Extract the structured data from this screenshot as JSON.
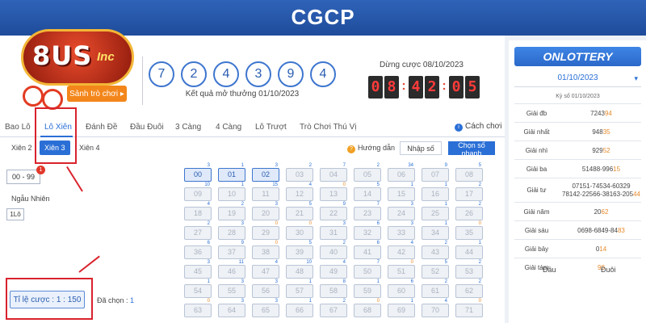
{
  "banner": {
    "title": "CGCP"
  },
  "logo": {
    "brand": "8US",
    "suffix": "Inc"
  },
  "play_button": "Sảnh trò chơi ▸",
  "results": {
    "numbers": [
      "7",
      "2",
      "4",
      "3",
      "9",
      "4"
    ],
    "label": "Kết quả mở thưởng 01/10/2023"
  },
  "deadline": {
    "label": "Dừng cược 08/10/2023",
    "digits": [
      "0",
      "8",
      "4",
      "2",
      "0",
      "5"
    ],
    "sep": ":"
  },
  "tabs": [
    "Bao Lô",
    "Lô Xiên",
    "Đánh Đề",
    "Đầu Đuôi",
    "3 Càng",
    "4 Càng",
    "Lô Trượt",
    "Trò Chơi Thú Vị"
  ],
  "help_link": "Cách chơi",
  "subtabs": [
    "Xiên 2",
    "Xiên 3",
    "Xiên 4"
  ],
  "guide_link": "Hướng dẫn",
  "enter_number": "Nhập số",
  "quick_pick": "Chọn số nhanh",
  "range_button": "00 - 99",
  "range_badge": "1",
  "random_label": "Ngẫu Nhiên",
  "onelo": "1Lô",
  "odds": "Tỉ lệ cược : 1 : 150",
  "selected": {
    "label": "Đã chọn : ",
    "count": "1"
  },
  "grid": [
    {
      "n": "00",
      "c": "3",
      "s": true
    },
    {
      "n": "01",
      "c": "1",
      "s": true
    },
    {
      "n": "02",
      "c": "3",
      "s": true
    },
    {
      "n": "03",
      "c": "2"
    },
    {
      "n": "04",
      "c": "7"
    },
    {
      "n": "05",
      "c": "2"
    },
    {
      "n": "06",
      "c": "34"
    },
    {
      "n": "07",
      "c": "9"
    },
    {
      "n": "08",
      "c": "5"
    },
    {
      "n": "09",
      "c": "10"
    },
    {
      "n": "10",
      "c": "1"
    },
    {
      "n": "11",
      "c": "15"
    },
    {
      "n": "12",
      "c": "4"
    },
    {
      "n": "13",
      "c": "0",
      "h": true
    },
    {
      "n": "14",
      "c": "5"
    },
    {
      "n": "15",
      "c": "1"
    },
    {
      "n": "16",
      "c": "1"
    },
    {
      "n": "17",
      "c": "2"
    },
    {
      "n": "18",
      "c": "4"
    },
    {
      "n": "19",
      "c": "2"
    },
    {
      "n": "20",
      "c": "3"
    },
    {
      "n": "21",
      "c": "5"
    },
    {
      "n": "22",
      "c": "9"
    },
    {
      "n": "23",
      "c": "7"
    },
    {
      "n": "24",
      "c": "3"
    },
    {
      "n": "25",
      "c": "1"
    },
    {
      "n": "26",
      "c": "2"
    },
    {
      "n": "27",
      "c": "2"
    },
    {
      "n": "28",
      "c": "3"
    },
    {
      "n": "29",
      "c": "0",
      "h": true
    },
    {
      "n": "30",
      "c": "0",
      "h": true
    },
    {
      "n": "31",
      "c": "3"
    },
    {
      "n": "32",
      "c": "6"
    },
    {
      "n": "33",
      "c": "3"
    },
    {
      "n": "34",
      "c": "1"
    },
    {
      "n": "35",
      "c": "0",
      "h": true
    },
    {
      "n": "36",
      "c": "6"
    },
    {
      "n": "37",
      "c": "9"
    },
    {
      "n": "38",
      "c": "0",
      "h": true
    },
    {
      "n": "39",
      "c": "5"
    },
    {
      "n": "40",
      "c": "2"
    },
    {
      "n": "41",
      "c": "6"
    },
    {
      "n": "42",
      "c": "4"
    },
    {
      "n": "43",
      "c": "2"
    },
    {
      "n": "44",
      "c": "1"
    },
    {
      "n": "45",
      "c": "3"
    },
    {
      "n": "46",
      "c": "11"
    },
    {
      "n": "47",
      "c": "4"
    },
    {
      "n": "48",
      "c": "10"
    },
    {
      "n": "49",
      "c": "4"
    },
    {
      "n": "50",
      "c": "7"
    },
    {
      "n": "51",
      "c": "0",
      "h": true
    },
    {
      "n": "52",
      "c": "5"
    },
    {
      "n": "53",
      "c": "2"
    },
    {
      "n": "54",
      "c": "1"
    },
    {
      "n": "55",
      "c": "3"
    },
    {
      "n": "56",
      "c": "3"
    },
    {
      "n": "57",
      "c": "1"
    },
    {
      "n": "58",
      "c": "8"
    },
    {
      "n": "59",
      "c": "1"
    },
    {
      "n": "60",
      "c": "6"
    },
    {
      "n": "61",
      "c": "2"
    },
    {
      "n": "62",
      "c": "2"
    },
    {
      "n": "63",
      "c": "0",
      "h": true
    },
    {
      "n": "64",
      "c": "3"
    },
    {
      "n": "65",
      "c": "3"
    },
    {
      "n": "66",
      "c": "1"
    },
    {
      "n": "67",
      "c": "2"
    },
    {
      "n": "68",
      "c": "0",
      "h": true
    },
    {
      "n": "69",
      "c": "1"
    },
    {
      "n": "70",
      "c": "4"
    },
    {
      "n": "71",
      "c": "0",
      "h": true
    }
  ],
  "side": {
    "brand": "ONLOTTERY",
    "date": "01/10/2023",
    "draw_label": "Kỳ số 01/10/2023",
    "prizes": [
      {
        "name": "Giải đb",
        "lines": [
          {
            "a": "7243",
            "b": "94"
          }
        ]
      },
      {
        "name": "Giải nhất",
        "lines": [
          {
            "a": "948",
            "b": "35"
          }
        ]
      },
      {
        "name": "Giải nhì",
        "lines": [
          {
            "a": "929",
            "b": "52"
          }
        ]
      },
      {
        "name": "Giải ba",
        "lines": [
          {
            "a": "51488-996",
            "b": "15"
          }
        ]
      },
      {
        "name": "Giải tư",
        "lines": [
          {
            "a": "07151-74534-60329",
            "b": ""
          },
          {
            "a": "78142-22566-38163-205",
            "b": "44"
          }
        ]
      },
      {
        "name": "Giải năm",
        "lines": [
          {
            "a": "20",
            "b": "62"
          }
        ]
      },
      {
        "name": "Giải sáu",
        "lines": [
          {
            "a": "0698-6849-84",
            "b": "83"
          }
        ]
      },
      {
        "name": "Giải bảy",
        "lines": [
          {
            "a": "0",
            "b": "14"
          }
        ]
      },
      {
        "name": "Giải tám",
        "lines": [
          {
            "a": "",
            "b": "98"
          }
        ]
      }
    ],
    "col_head": "Đầu",
    "col_tail": "Đuôi"
  },
  "colors": {
    "accent": "#2a6fd6",
    "highlight": "#d9232d",
    "orange": "#f3861b"
  }
}
